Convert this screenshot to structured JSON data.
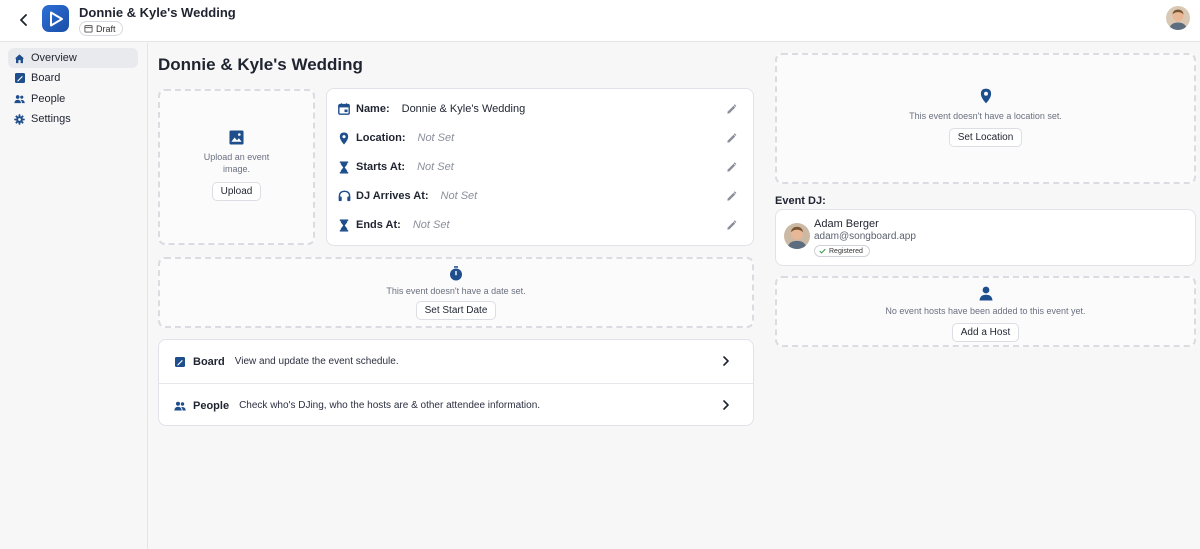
{
  "header": {
    "title": "Donnie & Kyle's Wedding",
    "status_badge": "Draft"
  },
  "sidebar": {
    "items": [
      {
        "label": "Overview",
        "icon": "home-icon",
        "active": true
      },
      {
        "label": "Board",
        "icon": "board-icon",
        "active": false
      },
      {
        "label": "People",
        "icon": "people-icon",
        "active": false
      },
      {
        "label": "Settings",
        "icon": "gear-icon",
        "active": false
      }
    ]
  },
  "main": {
    "page_title": "Donnie & Kyle's Wedding",
    "upload": {
      "message": "Upload an event image.",
      "button": "Upload"
    },
    "details": {
      "name_label": "Name:",
      "name_value": "Donnie & Kyle's Wedding",
      "location_label": "Location:",
      "location_value": "Not Set",
      "starts_label": "Starts At:",
      "starts_value": "Not Set",
      "dj_arrives_label": "DJ Arrives At:",
      "dj_arrives_value": "Not Set",
      "ends_label": "Ends At:",
      "ends_value": "Not Set"
    },
    "date": {
      "message": "This event doesn't have a date set.",
      "button": "Set Start Date"
    },
    "links": {
      "board_label": "Board",
      "board_desc": "View and update the event schedule.",
      "people_label": "People",
      "people_desc": "Check who's DJing, who the hosts are & other attendee information."
    }
  },
  "right": {
    "location": {
      "message": "This event doesn't have a location set.",
      "button": "Set Location"
    },
    "dj": {
      "heading": "Event DJ:",
      "name": "Adam Berger",
      "email": "adam@songboard.app",
      "badge": "Registered"
    },
    "hosts": {
      "message": "No event hosts have been added to this event yet.",
      "button": "Add a Host"
    }
  },
  "colors": {
    "accent": "#1f4e8c",
    "logo": "#2c6fd6",
    "registered": "#3a9a4a"
  }
}
